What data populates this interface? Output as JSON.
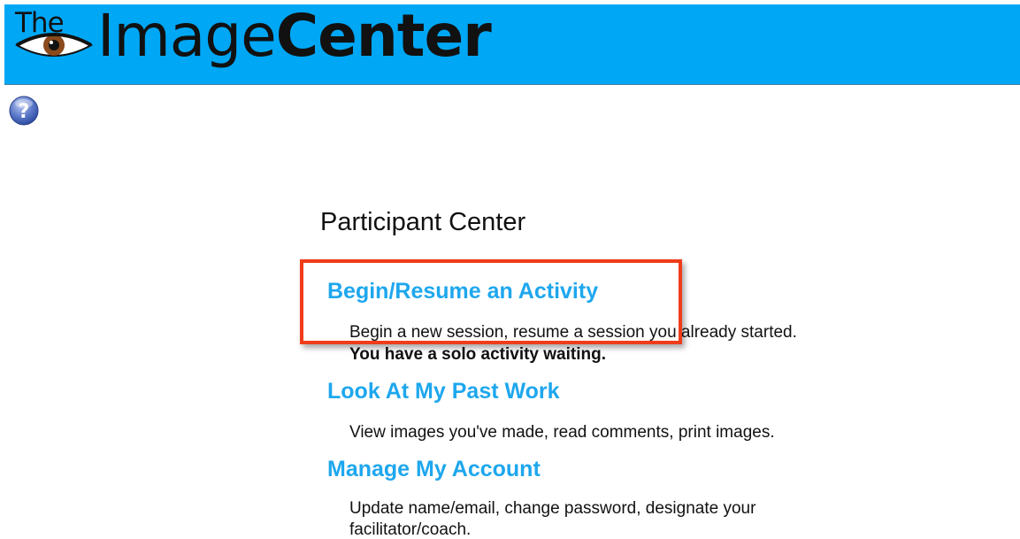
{
  "header": {
    "logo_the": "The",
    "logo_image": "Image",
    "logo_center": "Center",
    "background_color": "#00a7f5"
  },
  "help": {
    "icon": "question-icon"
  },
  "main": {
    "title": "Participant Center",
    "sections": [
      {
        "link": "Begin/Resume an Activity",
        "description": "Begin a new session, resume a session you already started.",
        "note": "You have a solo activity waiting."
      },
      {
        "link": "Look At My Past Work",
        "description": "View images you've made, read comments, print images."
      },
      {
        "link": "Manage My Account",
        "description_line1": "Update name/email, change password, designate your",
        "description_line2": "facilitator/coach."
      }
    ]
  },
  "colors": {
    "link": "#1ea7ee",
    "highlight": "#f03c1a"
  }
}
